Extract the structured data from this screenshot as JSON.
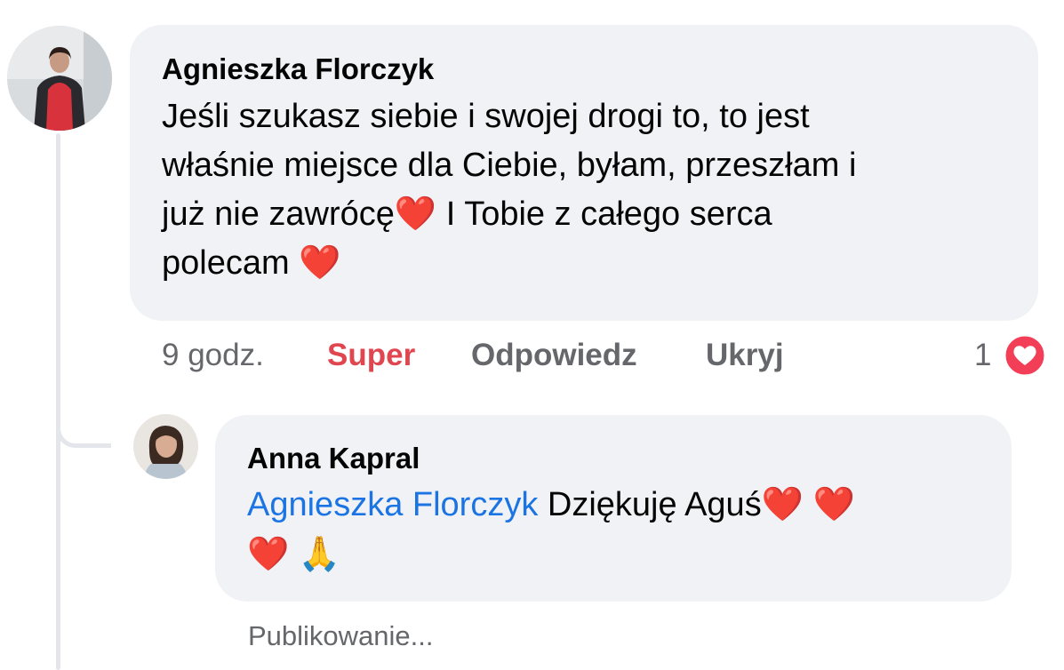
{
  "thread": {
    "comment": {
      "author": "Agnieszka Florczyk",
      "text_lines": [
        "Jeśli szukasz siebie i swojej drogi to, to jest",
        "właśnie miejsce dla Ciebie, byłam, przeszłam i",
        "już nie zawrócę❤️ I Tobie z całego serca",
        "polecam ❤️"
      ],
      "actions": {
        "time": "9 godz.",
        "super": "Super",
        "reply": "Odpowiedz",
        "hide": "Ukryj"
      },
      "reaction_count": "1",
      "reaction_icon": "love-reaction-icon"
    },
    "reply": {
      "author": "Anna Kapral",
      "mention": "Agnieszka Florczyk",
      "text_line_1": " Dziękuję Aguś❤️ ❤️",
      "text_line_2": "❤️ 🙏",
      "status": "Publikowanie..."
    }
  },
  "colors": {
    "bubble": "#f0f2f5",
    "mention": "#1b74e4",
    "super": "#e0464f",
    "muted": "#65676b",
    "love_reaction": "#f33e58"
  }
}
